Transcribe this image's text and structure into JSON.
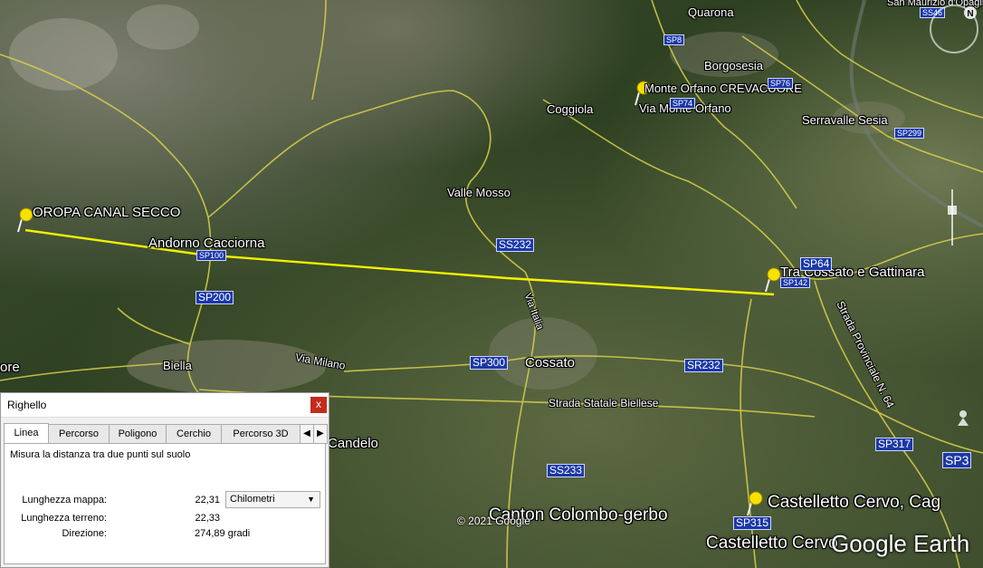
{
  "map": {
    "places": [
      {
        "id": "quarona",
        "label": "Quarona",
        "size": "sm"
      },
      {
        "id": "borgosesia",
        "label": "Borgosesia",
        "size": "sm"
      },
      {
        "id": "san-maurizio",
        "label": "San Maurizio d'Opaglio",
        "size": "sm"
      },
      {
        "id": "monte-orfano",
        "label": "Monte Orfano CREVACUORE",
        "size": "sm"
      },
      {
        "id": "via-monte-orfano",
        "label": "Via Monte Orfano",
        "size": "sm"
      },
      {
        "id": "coggiola",
        "label": "Coggiola",
        "size": "sm"
      },
      {
        "id": "serravalle",
        "label": "Serravalle Sesia",
        "size": "sm"
      },
      {
        "id": "oropa",
        "label": "OROPA CANAL SECCO",
        "size": "md"
      },
      {
        "id": "valle-mosso",
        "label": "Valle Mosso",
        "size": "sm"
      },
      {
        "id": "andorno",
        "label": "Andorno Cacciorna",
        "size": "md"
      },
      {
        "id": "cossato-gattinara",
        "label": "Tra Cossato e Gattinara",
        "size": "md"
      },
      {
        "id": "biella",
        "label": "Biella",
        "size": "sm"
      },
      {
        "id": "ore",
        "label": "ore",
        "size": "md"
      },
      {
        "id": "cossato",
        "label": "Cossato",
        "size": "md"
      },
      {
        "id": "candelo",
        "label": "Candelo",
        "size": "md"
      },
      {
        "id": "canton",
        "label": "Canton Colombo-gerbo",
        "size": "lg"
      },
      {
        "id": "castelletto-cag",
        "label": "Castelletto Cervo, Cag",
        "size": "lg"
      },
      {
        "id": "castelletto",
        "label": "Castelletto Cervo",
        "size": "lg"
      }
    ],
    "roads": [
      "SP8",
      "SP76",
      "SP74",
      "SP299",
      "SS232",
      "SP100",
      "SP200",
      "SP300",
      "SR232",
      "SP64",
      "SP142",
      "SP317",
      "SP3",
      "SS233",
      "SP315",
      "SS46",
      "SS232"
    ],
    "streets": [
      "Via Milano",
      "Strada Statale Biellese",
      "Via Italia",
      "Strada Provinciale N. 64"
    ],
    "copyright": "© 2021 Google",
    "logo": "Google Earth",
    "north": "N",
    "measure_line_color": "#f3f000"
  },
  "ruler": {
    "title": "Righello",
    "close": "x",
    "tabs": [
      "Linea",
      "Percorso",
      "Poligono",
      "Cerchio",
      "Percorso 3D"
    ],
    "active_tab": "Linea",
    "description": "Misura la distanza tra due punti sul suolo",
    "map_length_label": "Lunghezza mappa:",
    "map_length_value": "22,31",
    "ground_length_label": "Lunghezza terreno:",
    "ground_length_value": "22,33",
    "heading_label": "Direzione:",
    "heading_value": "274,89 gradi",
    "units": "Chilometri"
  }
}
